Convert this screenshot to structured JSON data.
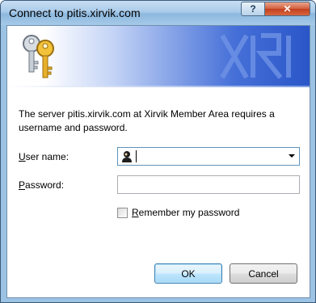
{
  "window": {
    "title": "Connect to pitis.xirvik.com",
    "help_label": "?",
    "close_label": "✕"
  },
  "dialog": {
    "message_line1": "The server pitis.xirvik.com at Xirvik Member Area requires a",
    "message_line2": "username and password.",
    "username": {
      "label_first": "U",
      "label_rest": "ser name:",
      "value": ""
    },
    "password": {
      "label_first": "P",
      "label_rest": "assword:",
      "value": ""
    },
    "remember": {
      "label_first": "R",
      "label_rest": "emember my password",
      "checked": false
    },
    "ok_label": "OK",
    "cancel_label": "Cancel"
  },
  "colors": {
    "titlebar": "#a9cbea",
    "banner_dark": "#2a56c8",
    "close_button": "#c23f1d"
  },
  "icons": [
    "keys-icon",
    "user-avatar-icon",
    "dropdown-arrow-icon",
    "checkbox"
  ]
}
